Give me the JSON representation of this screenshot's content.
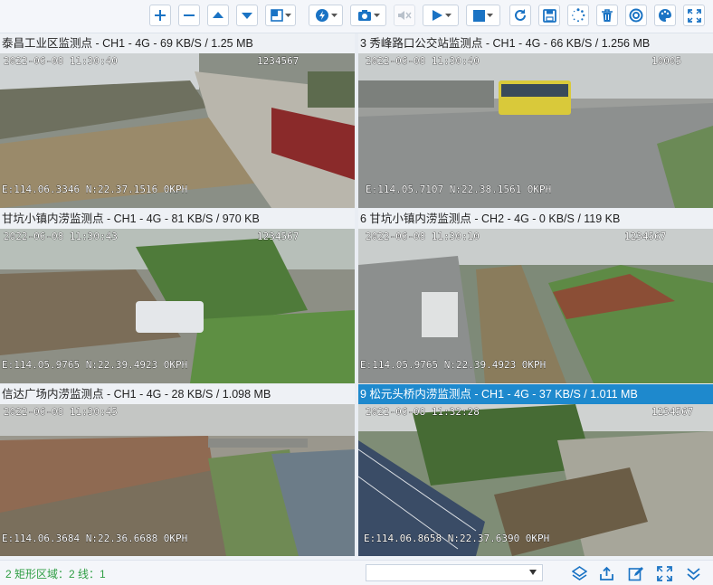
{
  "toolbar": {
    "buttons": [
      {
        "name": "add-icon"
      },
      {
        "name": "minus-icon"
      },
      {
        "name": "arrow-up-icon"
      },
      {
        "name": "arrow-down-icon"
      },
      {
        "name": "layout-icon"
      },
      {
        "name": "speed-icon"
      },
      {
        "name": "camera-icon"
      },
      {
        "name": "mute-icon"
      },
      {
        "name": "play-icon"
      },
      {
        "name": "stop-icon"
      },
      {
        "name": "refresh-icon"
      },
      {
        "name": "save-icon"
      },
      {
        "name": "loading-icon"
      },
      {
        "name": "delete-icon"
      },
      {
        "name": "target-icon"
      },
      {
        "name": "palette-icon"
      },
      {
        "name": "fullscreen-icon"
      }
    ],
    "colors": {
      "accent": "#1e89cd",
      "icon": "#1a73c4"
    }
  },
  "cells": [
    {
      "title": "泰昌工业区监测点 - CH1 - 4G - 69 KB/S / 1.25 MB",
      "ts": "2022-06-08 11:30:40",
      "id": "1234567",
      "coords": "E:114.06.3346 N:22.37.1516 0KPH",
      "active": false
    },
    {
      "title": "3  秀峰路口公交站监测点 - CH1 - 4G - 66 KB/S / 1.256 MB",
      "ts": "2022-06-08 11:30:40",
      "id": "10005",
      "coords": "E:114.05.7107 N:22.38.1561 0KPH",
      "active": false
    },
    {
      "title": "甘坑小镇内涝监测点 - CH1 - 4G - 81 KB/S / 970 KB",
      "ts": "2022-06-08 11:30:43",
      "id": "1234567",
      "coords": "E:114.05.9765 N:22.39.4923 0KPH",
      "active": false
    },
    {
      "title": "6  甘坑小镇内涝监测点 - CH2 - 4G - 0 KB/S / 119 KB",
      "ts": "2022-06-08 11:30:10",
      "id": "1234567",
      "coords": "E:114.05.9765 N:22.39.4923 0KPH",
      "active": false
    },
    {
      "title": "信达广场内涝监测点 - CH1 - 4G - 28 KB/S / 1.098 MB",
      "ts": "2022-06-08 11:30:45",
      "id": "",
      "coords": "E:114.06.3684 N:22.36.6688 0KPH",
      "active": false
    },
    {
      "title": "9  松元头桥内涝监测点 - CH1 - 4G - 37 KB/S / 1.011 MB",
      "ts": "2022-06-08 11:32:28",
      "id": "1234567",
      "coords": "E:114.06.8658 N:22.37.6390 0KPH",
      "active": true
    }
  ],
  "status": {
    "text": "2    矩形区域：2  线：1",
    "combo_value": ""
  }
}
